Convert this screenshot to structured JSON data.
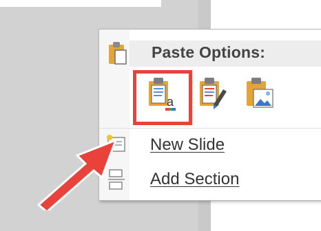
{
  "context_menu": {
    "header": "Paste Options:",
    "paste_options": [
      {
        "icon": "paste-keep-text-only-icon"
      },
      {
        "icon": "paste-keep-source-formatting-icon"
      },
      {
        "icon": "paste-picture-icon"
      }
    ],
    "items": [
      {
        "label": "New Slide",
        "accelerator": "N",
        "icon": "new-slide-icon"
      },
      {
        "label": "Add Section",
        "accelerator": "A",
        "icon": "add-section-icon"
      }
    ]
  },
  "colors": {
    "highlight": "#e8423a",
    "arrow": "#e8423a",
    "clipboard": "#e3a53a"
  }
}
